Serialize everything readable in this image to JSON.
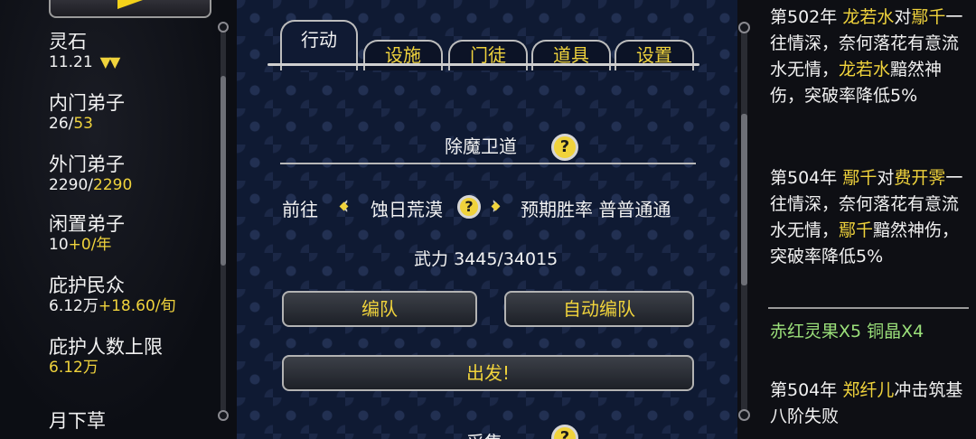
{
  "left": {
    "resources": [
      {
        "label": "灵石",
        "value": "11.21",
        "extra": "",
        "arrows": "▼▼"
      },
      {
        "label": "内门弟子",
        "value": "26/",
        "extra": "53"
      },
      {
        "label": "外门弟子",
        "value": "2290/",
        "extra": "2290"
      },
      {
        "label": "闲置弟子",
        "value": "10",
        "extra": "+0/年"
      },
      {
        "label": "庇护民众",
        "value": "6.12万",
        "extra": "+18.60/旬"
      },
      {
        "label": "庇护人数上限",
        "value": "",
        "extra": "6.12万"
      },
      {
        "label": "月下草",
        "value": "",
        "extra": ""
      }
    ]
  },
  "tabs": [
    {
      "label": "行动",
      "active": true
    },
    {
      "label": "设施"
    },
    {
      "label": "门徒"
    },
    {
      "label": "道具"
    },
    {
      "label": "设置"
    }
  ],
  "mission": {
    "title": "除魔卫道",
    "go_label": "前往",
    "location": "蚀日荒漠",
    "expect_label": "预期胜率",
    "expect_value": "普普通通",
    "power_label": "武力",
    "power_value": "3445/34015",
    "team_button": "编队",
    "auto_team_button": "自动编队",
    "depart_button": "出发!",
    "next_section": "采集"
  },
  "log": {
    "entry1": {
      "prefix": "第502年 ",
      "name1": "龙若水",
      "t1": "对",
      "name2": "鄢千",
      "t2": "一往情深，奈何落花有意流水无情，",
      "name3": "龙若水",
      "t3": "黯然神伤，突破率降低5%"
    },
    "entry2": {
      "prefix": "第504年 ",
      "name1": "鄢千",
      "t1": "对",
      "name2": "费开霁",
      "t2": "一往情深，奈何落花有意流水无情，",
      "name3": "鄢千",
      "t3": "黯然神伤，突破率降低5%"
    },
    "loot": "赤红灵果X5 铜晶X4",
    "entry3": {
      "prefix": "第504年 ",
      "name1": "郑纤儿",
      "t1": "冲击筑基八阶失败"
    }
  },
  "colors": {
    "highlight": "#f0d33c",
    "loot": "#9be07a",
    "panel": "#0f1a33"
  }
}
